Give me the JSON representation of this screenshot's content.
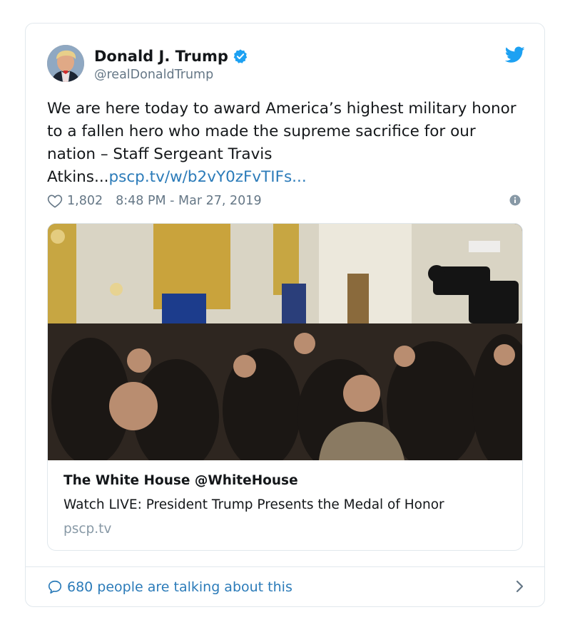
{
  "tweet": {
    "author_name": "Donald J. Trump",
    "handle": "@realDonaldTrump",
    "text": "We are here today to award America’s highest military honor to a fallen hero who made the supreme sacrifice for our nation – Staff Sergeant Travis Atkins...",
    "link_text": "pscp.tv/w/b2vY0zFvTIFs...",
    "likes": "1,802",
    "timestamp": "8:48 PM - Mar 27, 2019"
  },
  "media_card": {
    "title": "The White House @WhiteHouse",
    "description": "Watch LIVE: President Trump Presents the Medal of Honor",
    "domain": "pscp.tv"
  },
  "footer": {
    "label": "680 people are talking about this"
  },
  "colors": {
    "link": "#2b7bb9",
    "verified": "#1da1f2",
    "muted": "#657786",
    "border": "#e1e8ed"
  }
}
